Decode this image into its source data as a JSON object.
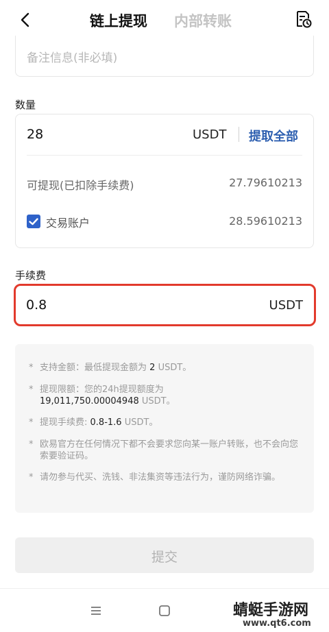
{
  "header": {
    "tab_active": "链上提现",
    "tab_inactive": "内部转账"
  },
  "memo": {
    "placeholder": "备注信息(非必填)"
  },
  "amount": {
    "label": "数量",
    "value": "28",
    "unit": "USDT",
    "withdraw_all": "提取全部",
    "available_label": "可提现(已扣除手续费)",
    "available_value": "27.79610213",
    "account_label": "交易账户",
    "account_value": "28.59610213",
    "account_checked": true
  },
  "fee": {
    "label": "手续费",
    "value": "0.8",
    "unit": "USDT"
  },
  "notice": {
    "star": "*",
    "item1_prefix": "支持金额：最低提现金额为",
    "item1_amount": "2",
    "item1_unit": "USDT。",
    "item2_prefix": "提现限额：您的24h提现额度为",
    "item2_amount": "19,011,750.00004948",
    "item2_unit": "USDT。",
    "item3_prefix": "提现手续费:",
    "item3_range": "0.8-1.6",
    "item3_unit": "USDT。",
    "item4": "欧易官方在任何情况下都不会要求您向某一账户转账，也不会向您索要验证码。",
    "item5": "请勿参与代买、洗钱、非法集资等违法行为，谨防网络诈骗。"
  },
  "submit": {
    "label": "提交"
  },
  "watermark": {
    "title": "蜻蜓手游网",
    "url": "www.qt6.com"
  },
  "colors": {
    "accent_blue": "#2d5fb0",
    "checkbox_blue": "#2e62c9",
    "highlight_red": "#e23a2c"
  }
}
